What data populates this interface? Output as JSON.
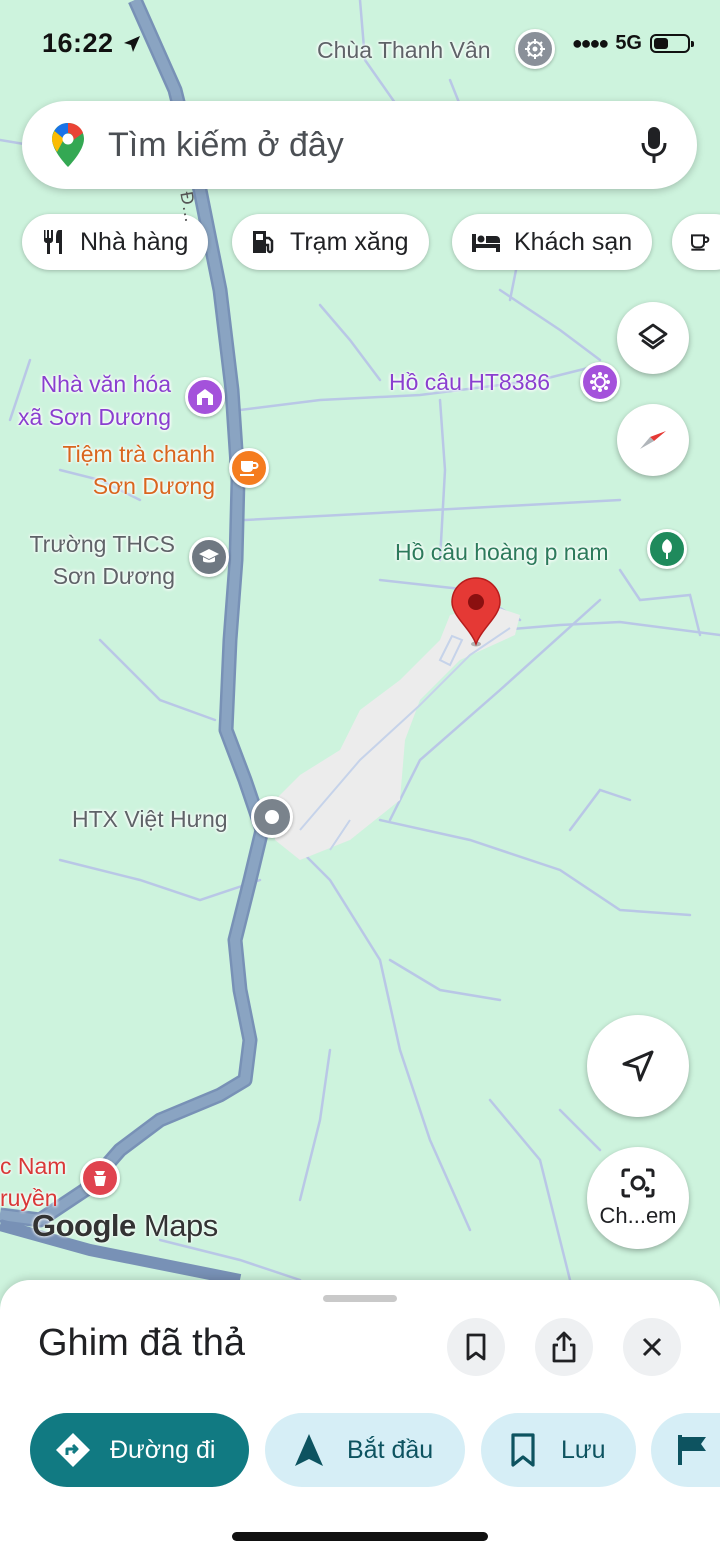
{
  "status_bar": {
    "time": "16:22",
    "network": "5G",
    "signal": "●●●●"
  },
  "search": {
    "placeholder": "Tìm kiếm ở đây"
  },
  "chips": [
    {
      "label": "Nhà hàng",
      "icon": "restaurant-icon"
    },
    {
      "label": "Trạm xăng",
      "icon": "gas-station-icon"
    },
    {
      "label": "Khách sạn",
      "icon": "hotel-icon"
    },
    {
      "label": "",
      "icon": "cafe-icon"
    }
  ],
  "map": {
    "places": [
      {
        "name": "Chùa Thanh Vân",
        "icon": "temple-icon"
      },
      {
        "name_line1": "Nhà văn hóa",
        "name_line2": "xã Sơn Dương",
        "icon": "community-hall-icon"
      },
      {
        "name": "Hồ câu HT8386",
        "icon": "attraction-icon"
      },
      {
        "name_line1": "Tiệm trà chanh",
        "name_line2": "Sơn Dương",
        "icon": "cafe-icon"
      },
      {
        "name_line1": "Trường THCS",
        "name_line2": "Sơn Dương",
        "icon": "school-icon"
      },
      {
        "name": "Hồ câu hoàng p nam",
        "icon": "park-icon"
      },
      {
        "name": "HTX Việt Hưng",
        "icon": "place-icon"
      },
      {
        "name_line1": "c Nam",
        "name_line2": "ruyền",
        "icon": "pharmacy-icon"
      }
    ],
    "road_label": "Đ…",
    "camera_button_label": "Ch...em",
    "attribution_google": "Google",
    "attribution_maps": "Maps",
    "colors": {
      "land": "#cdf3dd",
      "road": "#8aa4c2",
      "area": "#ececec",
      "pin": "#e53935"
    }
  },
  "sheet": {
    "title": "Ghim đã thả",
    "actions": [
      {
        "label": "Đường đi",
        "icon": "directions-icon"
      },
      {
        "label": "Bắt đầu",
        "icon": "navigation-start-icon"
      },
      {
        "label": "Lưu",
        "icon": "bookmark-icon"
      },
      {
        "label": "",
        "icon": "flag-icon"
      }
    ]
  }
}
